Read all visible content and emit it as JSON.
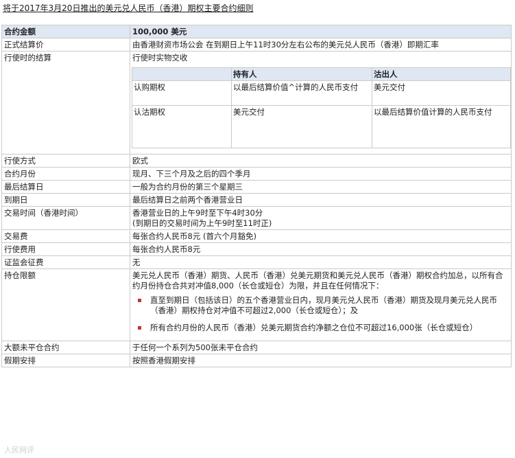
{
  "title": "将于2017年3月20日推出的美元兑人民币（香港）期权主要合约细则",
  "header": {
    "label": "合约金额",
    "value": "100,000 美元"
  },
  "rows": {
    "settle_price": {
      "label": "正式结算价",
      "value": "由香港财资市场公会 在到期日上午11时30分左右公布的美元兑人民币（香港）即期汇率"
    },
    "exercise_settle": {
      "label": "行使时的结算",
      "value": "行使时实物交收"
    },
    "style": {
      "label": "行使方式",
      "value": "欧式"
    },
    "months": {
      "label": "合约月份",
      "value": "现月、下三个月及之后的四个季月"
    },
    "last_settle": {
      "label": "最后结算日",
      "value": "一般为合约月份的第三个星期三"
    },
    "expiry": {
      "label": "到期日",
      "value": "最后结算日之前两个香港营业日"
    },
    "hours": {
      "label": "交易时间（香港时间）",
      "value1": "香港营业日的上午9时至下午4时30分",
      "value2": "(到期日的交易时间为上午9时至11时正)"
    },
    "fee": {
      "label": "交易费",
      "value": "每张合约人民币8元 (首六个月豁免)"
    },
    "exercise_fee": {
      "label": "行使费用",
      "value": "每张合约人民币8元"
    },
    "levy": {
      "label": "证监会征费",
      "value": "无"
    },
    "position": {
      "label": "持仓限额",
      "value": "美元兑人民币（香港）期货、人民币（香港）兑美元期货和美元兑人民币（香港）期权合约加总，以所有合约月份持仓合共对冲值8,000（长仓或短仓）为限，并且在任何情况下：",
      "bullet1": "直至到期日（包括该日）的五个香港营业日内，现月美元兑人民币（香港）期货及现月美元兑人民币（香港）期权持仓对冲值不可超过2,000（长仓或短仓）；及",
      "bullet2": "所有合约月份的人民币（香港）兑美元期货合约净额之仓位不可超过16,000张（长仓或短仓）"
    },
    "large": {
      "label": "大额未平仓合约",
      "value": "于任何一个系列为500张未平仓合约"
    },
    "holiday": {
      "label": "假期安排",
      "value": "按照香港假期安排"
    }
  },
  "settlement_table": {
    "col_holder": "持有人",
    "col_writer": "沽出人",
    "call": {
      "label": "认购期权",
      "holder": "以最后结算价值^计算的人民币支付",
      "writer": "美元交付"
    },
    "put": {
      "label": "认沽期权",
      "holder": "美元交付",
      "writer": "以最后结算价值计算的人民币支付"
    }
  },
  "watermark": "人民网评"
}
